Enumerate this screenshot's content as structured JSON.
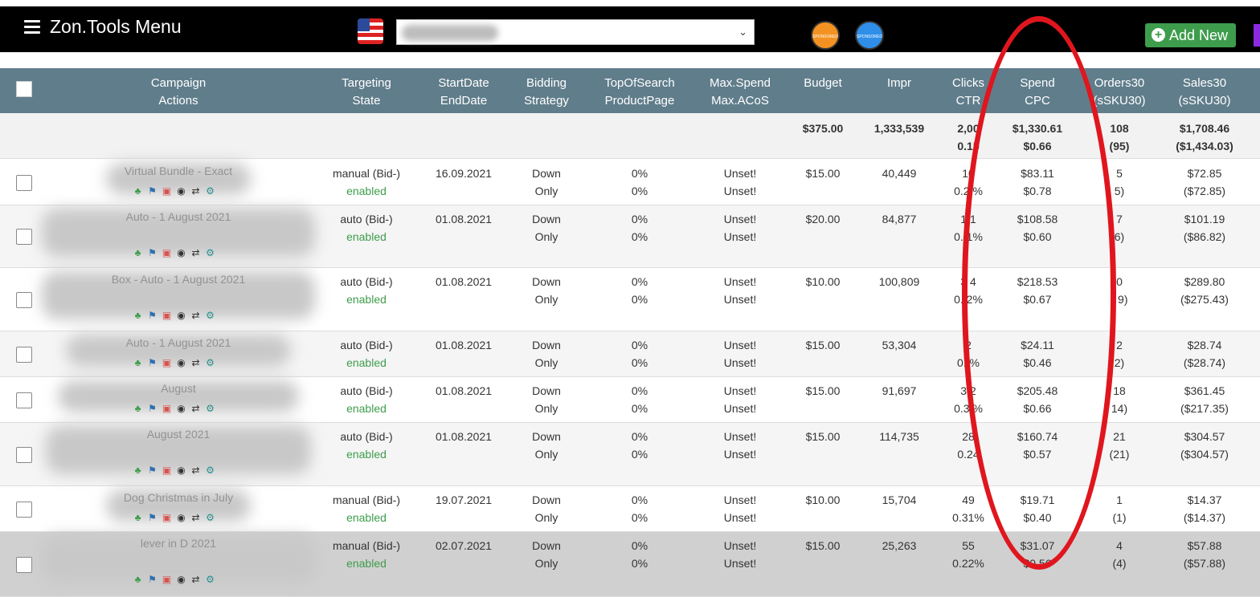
{
  "app": {
    "title": "Zon.Tools Menu",
    "add_new_label": "Add New",
    "badge_sb": "SPONSORED BRANDS",
    "badge_sd": "SPONSORED DISPLAY"
  },
  "header": {
    "col_campaign": [
      "Campaign",
      "Actions"
    ],
    "col_targeting": [
      "Targeting",
      "State"
    ],
    "col_dates": [
      "StartDate",
      "EndDate"
    ],
    "col_bidding": [
      "Bidding",
      "Strategy"
    ],
    "col_top": [
      "TopOfSearch",
      "ProductPage"
    ],
    "col_max": [
      "Max.Spend",
      "Max.ACoS"
    ],
    "col_budget": "Budget",
    "col_impr": "Impr",
    "col_clicks": [
      "Clicks",
      "CTR"
    ],
    "col_spend": [
      "Spend",
      "CPC"
    ],
    "col_orders": [
      "Orders30",
      "(sSKU30)"
    ],
    "col_sales": [
      "Sales30",
      "(sSKU30)"
    ]
  },
  "totals": {
    "budget": "$375.00",
    "impr": "1,333,539",
    "clicks": "2,00",
    "ctr": "0.15",
    "spend": "$1,330.61",
    "cpc": "$0.66",
    "orders": "108",
    "orders_sku": "(95)",
    "sales": "$1,708.46",
    "sales_sku": "($1,434.03)"
  },
  "rows": [
    {
      "campaign": "Virtual Bundle - Exact",
      "targeting": "manual",
      "bid": "(Bid-)",
      "state": "enabled",
      "start": "16.09.2021",
      "bid1": "Down",
      "bid2": "Only",
      "top": "0%",
      "pp": "0%",
      "max1": "Unset!",
      "max2": "Unset!",
      "budget": "$15.00",
      "impr": "40,449",
      "clicks": "10",
      "ctr": "0.2 %",
      "spend": "$83.11",
      "cpc": "$0.78",
      "orders": "5",
      "orders_sku": "5)",
      "sales": "$72.85",
      "sales_sku": "($72.85)"
    },
    {
      "campaign": "Auto - 1 August 2021",
      "targeting": "auto",
      "bid": "(Bid-)",
      "state": "enabled",
      "start": "01.08.2021",
      "bid1": "Down",
      "bid2": "Only",
      "top": "0%",
      "pp": "0%",
      "max1": "Unset!",
      "max2": "Unset!",
      "budget": "$20.00",
      "impr": "84,877",
      "clicks": "1 1",
      "ctr": "0. 1%",
      "spend": "$108.58",
      "cpc": "$0.60",
      "orders": "7",
      "orders_sku": "6)",
      "sales": "$101.19",
      "sales_sku": "($86.82)"
    },
    {
      "campaign": "Box - Auto - 1 August 2021",
      "targeting": "auto",
      "bid": "(Bid-)",
      "state": "enabled",
      "start": "01.08.2021",
      "bid1": "Down",
      "bid2": "Only",
      "top": "0%",
      "pp": "0%",
      "max1": "Unset!",
      "max2": "Unset!",
      "budget": "$10.00",
      "impr": "100,809",
      "clicks": "3 4",
      "ctr": "0. 2%",
      "spend": "$218.53",
      "cpc": "$0.67",
      "orders": "0",
      "orders_sku": "( 9)",
      "sales": "$289.80",
      "sales_sku": "($275.43)"
    },
    {
      "campaign": "Auto - 1 August 2021",
      "targeting": "auto",
      "bid": "(Bid-)",
      "state": "enabled",
      "start": "01.08.2021",
      "bid1": "Down",
      "bid2": "Only",
      "top": "0%",
      "pp": "0%",
      "max1": "Unset!",
      "max2": "Unset!",
      "budget": "$15.00",
      "impr": "53,304",
      "clicks": "2",
      "ctr": "0. %",
      "spend": "$24.11",
      "cpc": "$0.46",
      "orders": "2",
      "orders_sku": "2)",
      "sales": "$28.74",
      "sales_sku": "($28.74)"
    },
    {
      "campaign": "August",
      "targeting": "auto",
      "bid": "(Bid-)",
      "state": "enabled",
      "start": "01.08.2021",
      "bid1": "Down",
      "bid2": "Only",
      "top": "0%",
      "pp": "0%",
      "max1": "Unset!",
      "max2": "Unset!",
      "budget": "$15.00",
      "impr": "91,697",
      "clicks": "3 2",
      "ctr": "0.3 %",
      "spend": "$205.48",
      "cpc": "$0.66",
      "orders": "18",
      "orders_sku": "14)",
      "sales": "$361.45",
      "sales_sku": "($217.35)"
    },
    {
      "campaign": "August 2021",
      "targeting": "auto",
      "bid": "(Bid-)",
      "state": "enabled",
      "start": "01.08.2021",
      "bid1": "Down",
      "bid2": "Only",
      "top": "0%",
      "pp": "0%",
      "max1": "Unset!",
      "max2": "Unset!",
      "budget": "$15.00",
      "impr": "114,735",
      "clicks": "28",
      "ctr": "0.24",
      "spend": "$160.74",
      "cpc": "$0.57",
      "orders": "21",
      "orders_sku": "(21)",
      "sales": "$304.57",
      "sales_sku": "($304.57)"
    },
    {
      "campaign": "Dog Christmas in July",
      "targeting": "manual",
      "bid": "(Bid-)",
      "state": "enabled",
      "start": "19.07.2021",
      "bid1": "Down",
      "bid2": "Only",
      "top": "0%",
      "pp": "0%",
      "max1": "Unset!",
      "max2": "Unset!",
      "budget": "$10.00",
      "impr": "15,704",
      "clicks": "49",
      "ctr": "0.31%",
      "spend": "$19.71",
      "cpc": "$0.40",
      "orders": "1",
      "orders_sku": "(1)",
      "sales": "$14.37",
      "sales_sku": "($14.37)"
    },
    {
      "campaign": "lever in D 2021",
      "targeting": "manual",
      "bid": "(Bid-)",
      "state": "enabled",
      "start": "02.07.2021",
      "bid1": "Down",
      "bid2": "Only",
      "top": "0%",
      "pp": "0%",
      "max1": "Unset!",
      "max2": "Unset!",
      "budget": "$15.00",
      "impr": "25,263",
      "clicks": "55",
      "ctr": "0.22%",
      "spend": "$31.07",
      "cpc": "$0.56",
      "orders": "4",
      "orders_sku": "(4)",
      "sales": "$57.88",
      "sales_sku": "($57.88)"
    }
  ]
}
